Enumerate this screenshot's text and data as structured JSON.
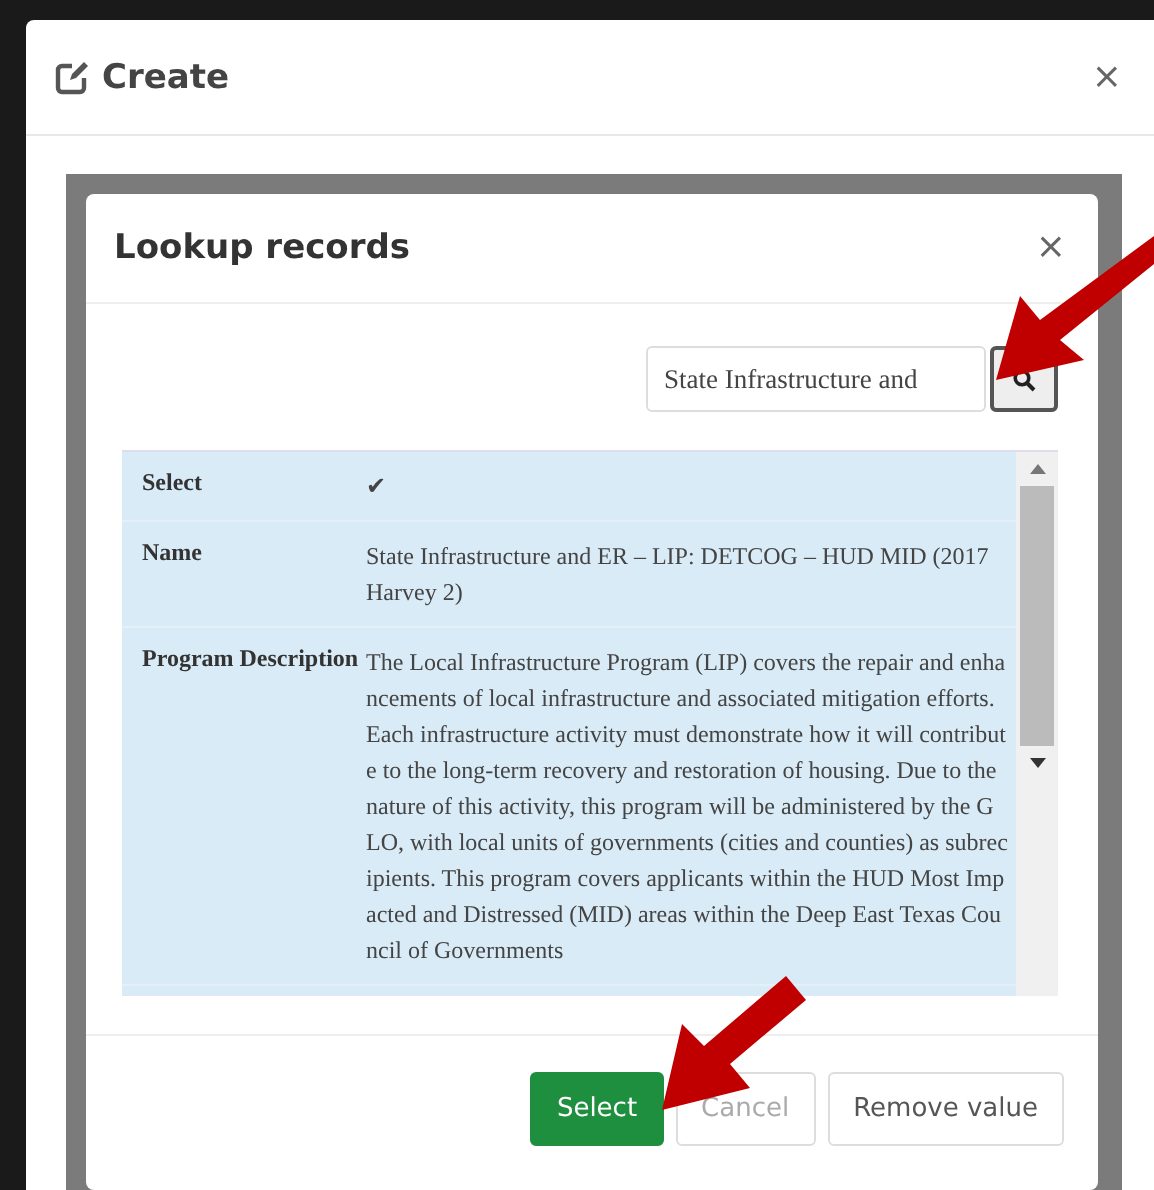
{
  "dialog": {
    "title": "Create",
    "close": "×"
  },
  "lookup": {
    "title": "Lookup records",
    "close": "×",
    "search": {
      "value": "State Infrastructure and"
    },
    "rows": [
      {
        "label": "Select",
        "value": "✔"
      },
      {
        "label": "Name",
        "value": "State Infrastructure and ER – LIP: DETCOG – HUD MID (2017 Harvey 2)"
      },
      {
        "label": "Program Description",
        "value": "The Local Infrastructure Program (LIP) covers the repair and enhancements of local infrastructure and associated mitigation efforts. Each infrastructure activity must demonstrate how it will contribute to the long-term recovery and restoration of housing. Due to the nature of this activity, this program will be administered by the GLO, with local units of governments (cities and counties) as subrecipients. This program covers applicants within the HUD Most Impacted and Distressed (MID) areas within the Deep East Texas Council of Governments"
      }
    ],
    "buttons": [
      {
        "label": "Select",
        "kind": "primary",
        "disabled": false
      },
      {
        "label": "Cancel",
        "kind": "default",
        "disabled": true
      },
      {
        "label": "Remove value",
        "kind": "default",
        "disabled": false
      }
    ]
  }
}
